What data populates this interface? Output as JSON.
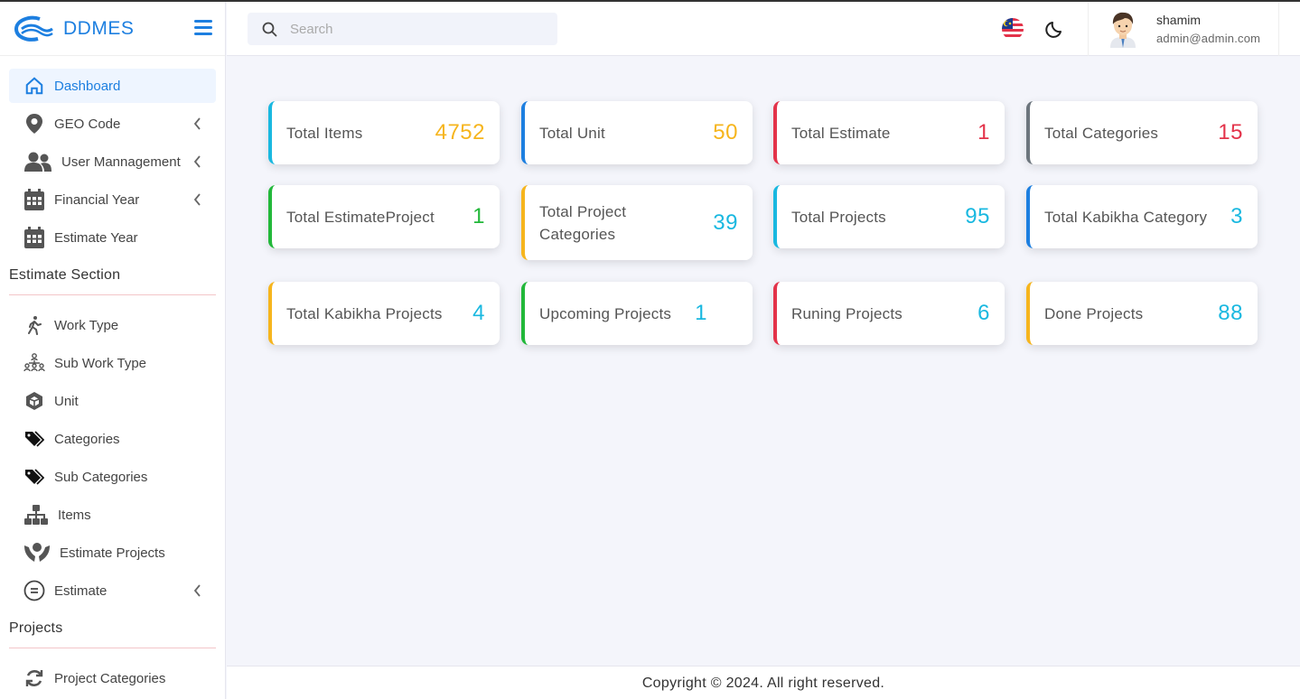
{
  "brand": {
    "name": "DDMES"
  },
  "search": {
    "placeholder": "Search"
  },
  "user": {
    "name": "shamim",
    "email": "admin@admin.com"
  },
  "sidebar": {
    "main_items": [
      {
        "label": "Dashboard",
        "icon": "home-icon",
        "active": true
      },
      {
        "label": "GEO Code",
        "icon": "map-pin-icon",
        "expandable": true
      },
      {
        "label": "User Mannagement",
        "icon": "users-icon",
        "expandable": true
      },
      {
        "label": "Financial Year",
        "icon": "calendar-icon",
        "expandable": true
      },
      {
        "label": "Estimate Year",
        "icon": "calendar-icon"
      }
    ],
    "estimate_section_title": "Estimate Section",
    "estimate_items": [
      {
        "label": "Work Type",
        "icon": "walking-person-icon"
      },
      {
        "label": "Sub Work Type",
        "icon": "people-network-icon"
      },
      {
        "label": "Unit",
        "icon": "cube-icon"
      },
      {
        "label": "Categories",
        "icon": "tags-icon"
      },
      {
        "label": "Sub Categories",
        "icon": "tags-icon"
      },
      {
        "label": "Items",
        "icon": "sitemap-icon"
      },
      {
        "label": "Estimate Projects",
        "icon": "hands-icon"
      },
      {
        "label": "Estimate",
        "icon": "equals-circle-icon",
        "expandable": true
      }
    ],
    "projects_section_title": "Projects",
    "project_items": [
      {
        "label": "Project Categories",
        "icon": "refresh-icon"
      }
    ]
  },
  "colors": {
    "primary": "#1d7fe0",
    "cyan": "#19b8e0",
    "blue": "#1d7fe0",
    "red": "#e3334a",
    "gray": "#6c757d",
    "green": "#22b83a",
    "yellow": "#f6b51d"
  },
  "cards": [
    {
      "title": "Total Items",
      "value": "4752",
      "border": "#19b8e0",
      "valueColor": "#f6b51d"
    },
    {
      "title": "Total Unit",
      "value": "50",
      "border": "#1d7fe0",
      "valueColor": "#f6b51d"
    },
    {
      "title": "Total Estimate",
      "value": "1",
      "border": "#e3334a",
      "valueColor": "#e3334a"
    },
    {
      "title": "Total Categories",
      "value": "15",
      "border": "#6c757d",
      "valueColor": "#e3334a"
    },
    {
      "title": "Total EstimateProject",
      "value": "1",
      "border": "#22b83a",
      "valueColor": "#22b83a"
    },
    {
      "title": "Total Project Categories",
      "value": "39",
      "border": "#f6b51d",
      "valueColor": "#19b8e0"
    },
    {
      "title": "Total Projects",
      "value": "95",
      "border": "#19b8e0",
      "valueColor": "#19b8e0"
    },
    {
      "title": "Total Kabikha Category",
      "value": "3",
      "border": "#1d7fe0",
      "valueColor": "#19b8e0"
    },
    {
      "title": "Total Kabikha Projects",
      "value": "4",
      "border": "#f6b51d",
      "valueColor": "#19b8e0"
    },
    {
      "title": "Upcoming Projects",
      "value": "1",
      "border": "#22b83a",
      "valueColor": "#19b8e0"
    },
    {
      "title": "Runing Projects",
      "value": "6",
      "border": "#e3334a",
      "valueColor": "#19b8e0"
    },
    {
      "title": "Done Projects",
      "value": "88",
      "border": "#f6b51d",
      "valueColor": "#19b8e0"
    }
  ],
  "footer": {
    "text": "Copyright © 2024. All right reserved."
  }
}
